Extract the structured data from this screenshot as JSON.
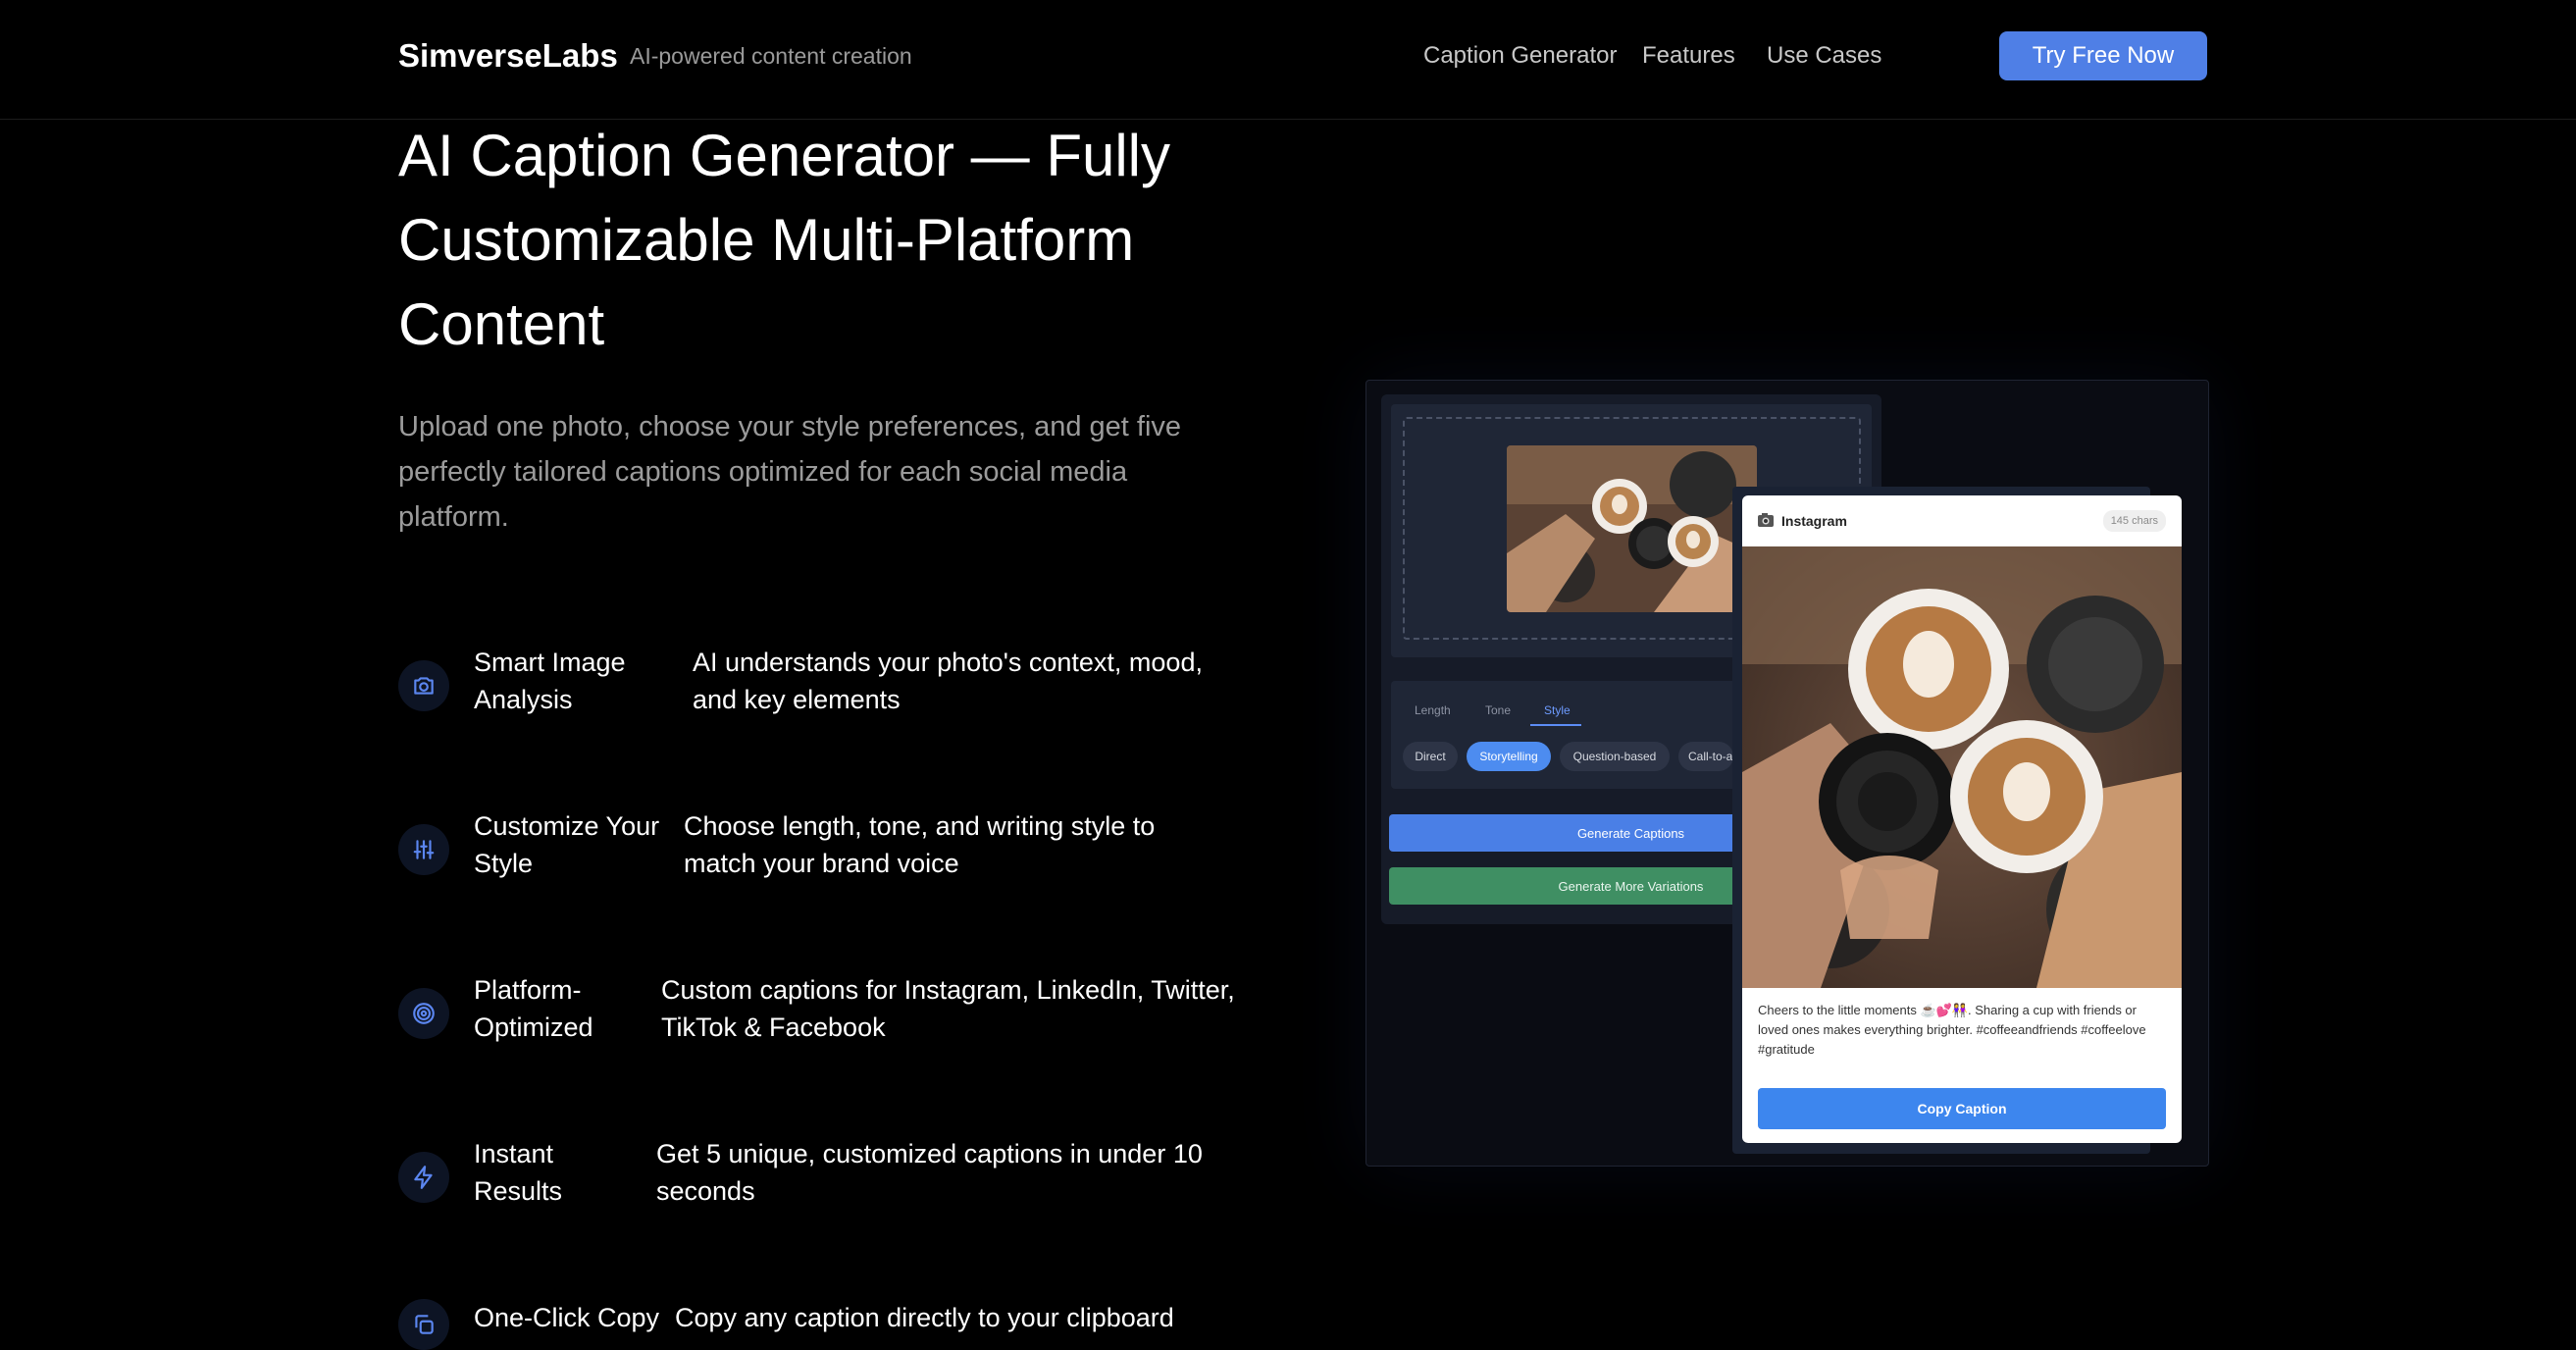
{
  "nav": {
    "brand": "SimverseLabs",
    "tagline": "AI-powered content creation",
    "links": [
      "Caption Generator",
      "Features",
      "Use Cases"
    ],
    "cta": "Try Free Now"
  },
  "hero": {
    "title": "AI Caption Generator — Fully Customizable Multi-Platform Content",
    "subtitle": "Upload one photo, choose your style preferences, and get five perfectly tailored captions optimized for each social media platform."
  },
  "features": [
    {
      "icon": "camera-icon",
      "title": "Smart Image Analysis",
      "desc": "AI understands your photo's context, mood, and key elements"
    },
    {
      "icon": "sliders-icon",
      "title": "Customize Your Style",
      "desc": "Choose length, tone, and writing style to match your brand voice"
    },
    {
      "icon": "target-icon",
      "title": "Platform-Optimized",
      "desc": "Custom captions for Instagram, LinkedIn, Twitter, TikTok & Facebook"
    },
    {
      "icon": "lightning-icon",
      "title": "Instant Results",
      "desc": "Get 5 unique, customized captions in under 10 seconds"
    },
    {
      "icon": "copy-icon",
      "title": "One-Click Copy",
      "desc": "Copy any caption directly to your clipboard"
    }
  ],
  "mockup": {
    "tabs": [
      "Length",
      "Tone",
      "Style"
    ],
    "active_tab": "Style",
    "pills": [
      "Direct",
      "Storytelling",
      "Question-based",
      "Call-to-a"
    ],
    "active_pill": "Storytelling",
    "generate_label": "Generate Captions",
    "variations_label": "Generate More Variations",
    "card": {
      "platform": "Instagram",
      "chars": "145 chars",
      "caption": "Cheers to the little moments ☕💕👭. Sharing a cup with friends or loved ones makes everything brighter. #coffeeandfriends #coffeelove #gratitude",
      "copy_label": "Copy Caption"
    }
  },
  "colors": {
    "accent": "#4f7fe6",
    "green": "#3f8f63",
    "icon_bg": "#0d1424",
    "icon_stroke": "#5b86f0"
  }
}
